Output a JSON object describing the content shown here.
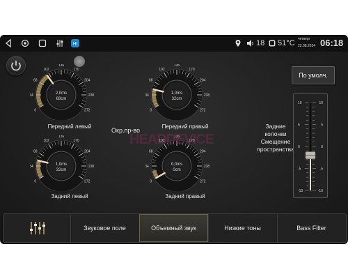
{
  "status_bar": {
    "volume": "18",
    "temperature": "51°C",
    "weekday": "четверг",
    "date": "22.08.2024",
    "time": "06:18"
  },
  "knobs": [
    {
      "id": "front-left",
      "label": "Передний левый",
      "value": "2,0ms",
      "distance": "68cm",
      "level": 0.35
    },
    {
      "id": "front-right",
      "label": "Передний правый",
      "value": "1,0ms",
      "distance": "32cm",
      "level": 0.18
    },
    {
      "id": "rear-left",
      "label": "Задний левый",
      "value": "1,0ms",
      "distance": "32cm",
      "level": 0.18
    },
    {
      "id": "rear-right",
      "label": "Задний правый",
      "value": "0,0ms",
      "distance": "0cm",
      "level": 0.0
    }
  ],
  "knob_ticks": [
    "0",
    "34",
    "68",
    "102",
    "136",
    "170",
    "204",
    "238",
    "272"
  ],
  "center_label": "Окр.пр-во",
  "watermark": "HEADDEVICE",
  "default_button": "По умолч.",
  "side_label_lines": [
    "Задние",
    "колонки",
    "Смещение",
    "пространства"
  ],
  "slider": {
    "ticks": [
      "10",
      "5",
      "0",
      "-5",
      "-10"
    ],
    "value": -2
  },
  "tabs": [
    {
      "label": "",
      "icon": "equalizer-icon",
      "active": false
    },
    {
      "label": "Звуковое поле",
      "active": false
    },
    {
      "label": "Объемный звук",
      "active": true
    },
    {
      "label": "Низкие тоны",
      "active": false
    },
    {
      "label": "Bass Filter",
      "active": false
    }
  ],
  "colors": {
    "accent": "#b89a5a",
    "knob_face": "#1a1a1a",
    "tab_active": "#3b3a33"
  }
}
